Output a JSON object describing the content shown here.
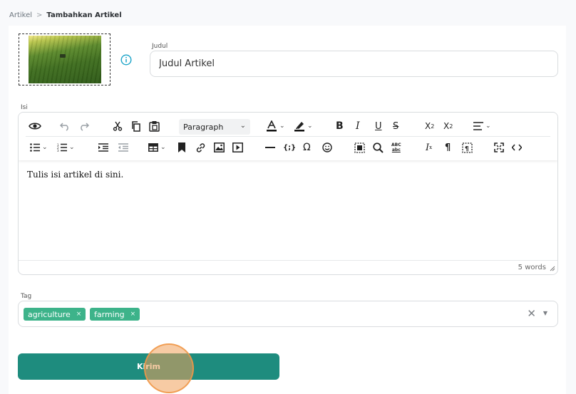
{
  "breadcrumb": {
    "parent": "Artikel",
    "separator": ">",
    "current": "Tambahkan Artikel"
  },
  "form": {
    "title_label": "Judul",
    "title_value": "Judul Artikel",
    "body_label": "Isi",
    "tag_label": "Tag",
    "submit_label": "Kirim"
  },
  "editor": {
    "block_format": "Paragraph",
    "content": "Tulis isi artikel di sini.",
    "word_count": "5 words"
  },
  "tags": [
    "agriculture",
    "farming"
  ],
  "colors": {
    "accent": "#1e8c7e",
    "chip": "#3db38a",
    "info": "#1aa3c8"
  }
}
